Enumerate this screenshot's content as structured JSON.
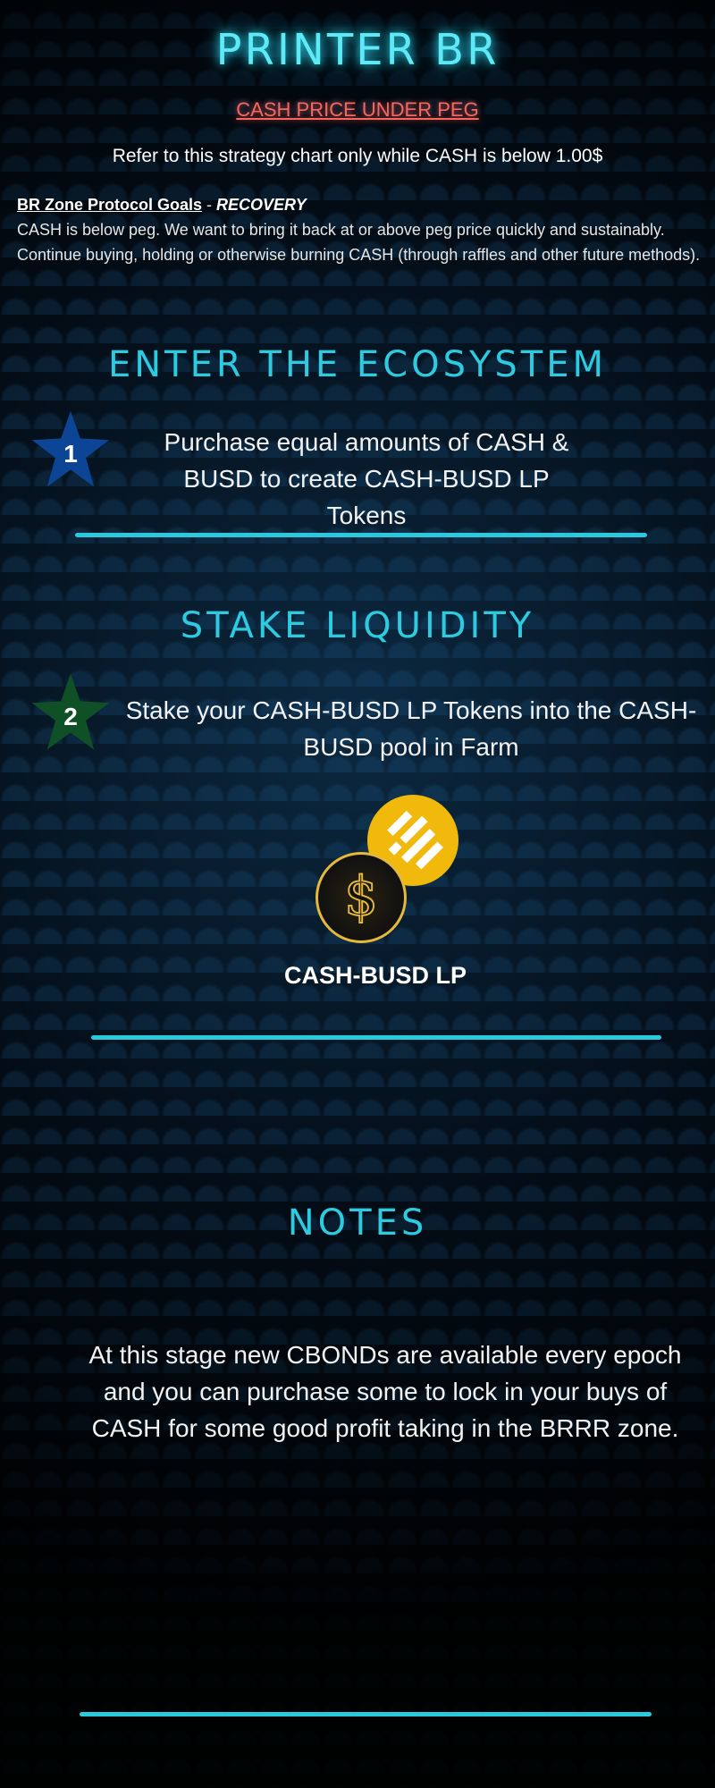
{
  "header": {
    "title": "PRINTER BR",
    "subtitle": "CASH PRICE UNDER PEG",
    "refer": "Refer to this strategy chart only while CASH is below 1.00$"
  },
  "goals": {
    "heading": "BR Zone Protocol Goals",
    "separator": " - ",
    "phase": "RECOVERY",
    "line1": "CASH is below peg. We want to bring it back at or above peg price quickly and sustainably.",
    "line2": "Continue buying, holding or otherwise burning CASH (through raffles and other future methods)."
  },
  "sections": [
    {
      "title": "ENTER THE ECOSYSTEM",
      "step_number": "1",
      "text": "Purchase equal amounts of CASH & BUSD to create CASH-BUSD LP Tokens",
      "star_color": "#0d4596"
    },
    {
      "title": "STAKE LIQUIDITY",
      "step_number": "2",
      "text": "Stake your CASH-BUSD LP Tokens into the CASH-BUSD pool in Farm",
      "star_color": "#0f5026",
      "token_label": "CASH-BUSD LP"
    },
    {
      "title": "NOTES",
      "text": "At this stage new CBONDs are available every epoch and you can purchase some to lock in your buys of CASH for some good profit taking in the BRRR zone."
    }
  ],
  "colors": {
    "accent": "#29c9de",
    "warning": "#f06a63",
    "busd": "#f0b90b"
  }
}
